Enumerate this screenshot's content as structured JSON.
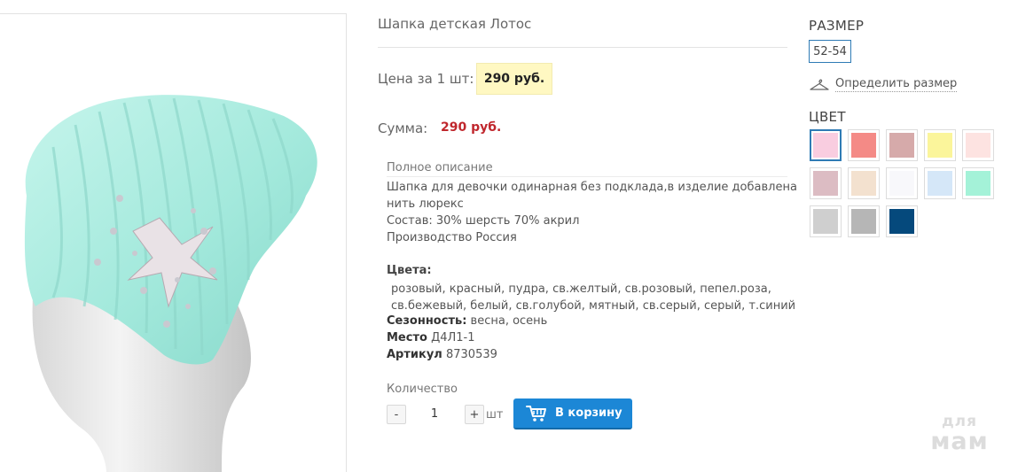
{
  "product": {
    "title": "Шапка детская Лотос",
    "price_label": "Цена за 1 шт:",
    "price": "290 руб.",
    "sum_label": "Сумма:",
    "sum": "290 руб."
  },
  "description": {
    "heading": "Полное описание",
    "lines": [
      "Шапка для девочки одинарная без подклада,в изделие добавлена",
      "нить люрекс",
      "Состав: 30% шерсть 70% акрил",
      "Производство Россия"
    ]
  },
  "properties": {
    "colors_label": "Цвета:",
    "colors_lines": [
      "розовый, красный, пудра, св.желтый, св.розовый, пепел.роза,",
      "св.бежевый, белый, св.голубой, мятный, св.серый, серый, т.синий"
    ],
    "season_label": "Сезонность:",
    "season_value": "весна, осень",
    "place_label": "Место",
    "place_value": "Д4Л1-1",
    "article_label": "Артикул",
    "article_value": "8730539"
  },
  "quantity": {
    "label": "Количество",
    "minus": "-",
    "value": "1",
    "plus": "+",
    "unit": "шт"
  },
  "cart_button": {
    "label": "В корзину",
    "icon": "cart-icon",
    "color": "#1c87d6"
  },
  "size": {
    "heading": "РАЗМЕР",
    "selected": "52-54",
    "guide_label": "Определить размер",
    "guide_icon": "hanger-icon"
  },
  "color_picker": {
    "heading": "ЦВЕТ",
    "selected_index": 0,
    "swatches": [
      "#f9cde0",
      "#f48a86",
      "#d6aaaa",
      "#fbf59b",
      "#fde3e1",
      "#dcbcc3",
      "#f3e1cf",
      "#f8f8fb",
      "#d5e7f8",
      "#a4f2d8",
      "#cfcfcf",
      "#b6b6b6",
      "#05497c"
    ]
  },
  "watermark": {
    "line1": "для",
    "line2": "мам"
  },
  "image": {
    "hat_color": "#a9ece0",
    "icon": "product-photo"
  }
}
